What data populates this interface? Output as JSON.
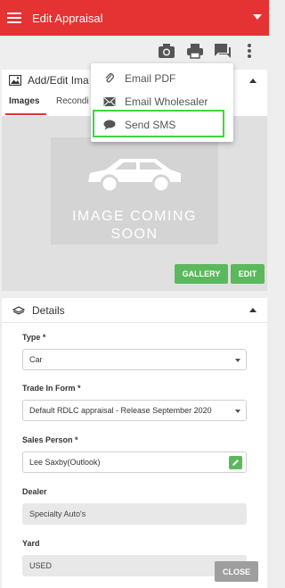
{
  "appbar": {
    "title": "Edit Appraisal"
  },
  "toolbar": {
    "icons": [
      "camera-icon",
      "print-icon",
      "chat-icon",
      "more-vert-icon"
    ]
  },
  "images_card": {
    "title": "Add/Edit Ima",
    "tabs": [
      "Images",
      "Recondi"
    ],
    "placeholder_line1": "IMAGE COMING",
    "placeholder_line2": "SOON",
    "gallery_label": "GALLERY",
    "edit_label": "EDIT"
  },
  "menu": {
    "items": [
      {
        "label": "Email PDF",
        "icon": "paperclip-icon"
      },
      {
        "label": "Email Wholesaler",
        "icon": "envelope-icon"
      },
      {
        "label": "Send SMS",
        "icon": "chat-bubble-icon"
      }
    ]
  },
  "details": {
    "title": "Details",
    "type_label": "Type *",
    "type_value": "Car",
    "trade_label": "Trade In Form *",
    "trade_value": "Default RDLC appraisal - Release September 2020",
    "sales_label": "Sales Person *",
    "sales_value": "Lee Saxby(Outlook)",
    "dealer_label": "Dealer",
    "dealer_value": "Specialty Auto's",
    "yard_label": "Yard",
    "yard_value": "USED"
  },
  "close_label": "CLOSE",
  "colors": {
    "brand": "#e53232",
    "action": "#5cb85c",
    "highlight": "#3fd63f"
  }
}
